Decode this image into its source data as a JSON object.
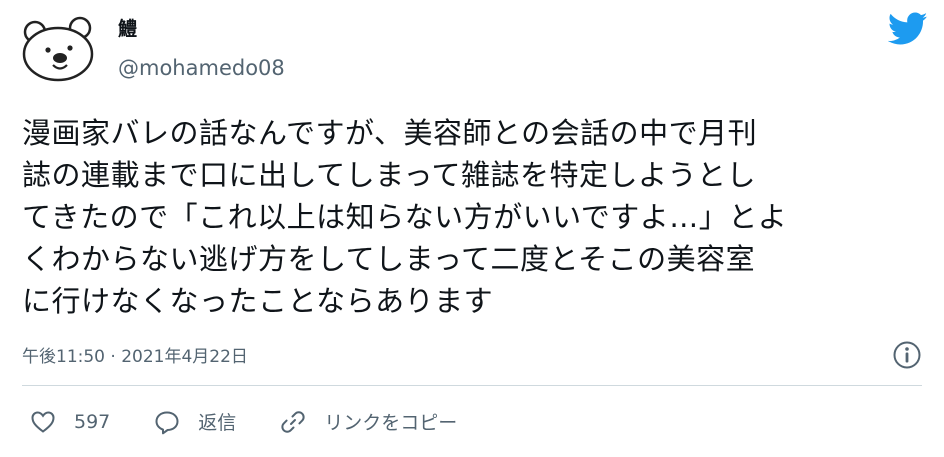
{
  "author": {
    "display_name": "鱧",
    "handle": "@mohamedo08"
  },
  "tweet": {
    "text": "漫画家バレの話なんですが、美容師との会話の中で月刊\n誌の連載まで口に出してしまって雑誌を特定しようとし\nてきたので「これ以上は知らない方がいいですよ…」とよ\nくわからない逃げ方をしてしまって二度とそこの美容室\nに行けなくなったことならあります",
    "timestamp": "午後11:50 · 2021年4月22日"
  },
  "actions": {
    "like_count": "597",
    "reply_label": "返信",
    "copy_link_label": "リンクをコピー"
  },
  "icons": {
    "avatar": "bear-avatar-icon",
    "logo": "twitter-bird-icon",
    "info": "info-icon",
    "like": "heart-icon",
    "reply": "speech-bubble-icon",
    "copy": "link-icon"
  },
  "colors": {
    "text": "#0f1419",
    "secondary": "#536471",
    "brand": "#1d9bf0",
    "divider": "#cfd9de"
  }
}
